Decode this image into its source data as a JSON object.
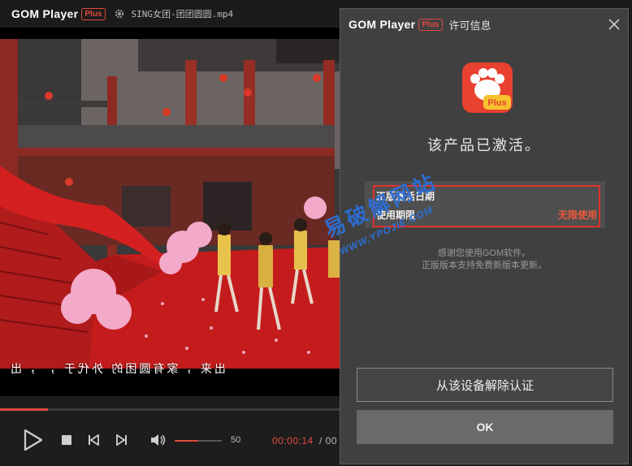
{
  "app": {
    "brand": "GOM Player",
    "plus": "Plus",
    "file_name": "SING女团-团团圆圆.mp4"
  },
  "video": {
    "subtitle": "出来 ，家有圆团的 外代于 ， ，出"
  },
  "playback": {
    "progress": 0.14,
    "volume_value": "50",
    "volume_level": 0.5,
    "current_time": "00:00:14",
    "total_time": "/ 00"
  },
  "dialog": {
    "title": "许可信息",
    "status": "该产品已激活。",
    "rows": [
      {
        "label": "正版激活日期",
        "value": ""
      },
      {
        "label": "使用期限",
        "value": "无限使用"
      }
    ],
    "thanks_line1": "感谢您使用GOM软件。",
    "thanks_line2": "正版版本支持免费新版本更新。",
    "deauth_button": "从该设备解除认证",
    "ok_button": "OK",
    "icon_badge": "Plus"
  },
  "watermark": {
    "cn": "易破解网站",
    "url": "WWW.YPOJIE.COM"
  },
  "colors": {
    "accent": "#e04a3c",
    "dialog_bg": "#404040",
    "highlight_border": "#e0302a"
  }
}
